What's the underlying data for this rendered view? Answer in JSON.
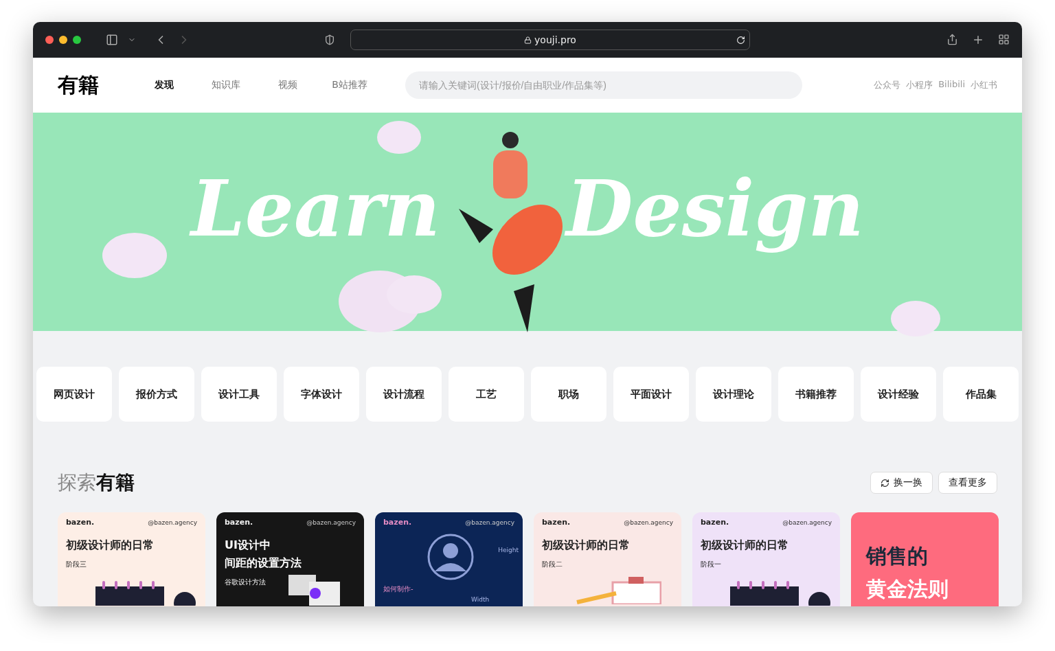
{
  "browser": {
    "url": "youji.pro"
  },
  "header": {
    "logo": "有籍",
    "nav": [
      {
        "label": "发现",
        "selected": true
      },
      {
        "label": "知识库",
        "selected": false
      },
      {
        "label": "视频",
        "selected": false
      },
      {
        "label": "B站推荐",
        "selected": false
      }
    ],
    "search": {
      "placeholder": "请输入关键词(设计/报价/自由职业/作品集等)"
    },
    "links": [
      "公众号",
      "小程序",
      "Bilibili",
      "小红书"
    ]
  },
  "hero": {
    "words": [
      "Learn",
      "Design"
    ]
  },
  "categories": [
    "网页设计",
    "报价方式",
    "设计工具",
    "字体设计",
    "设计流程",
    "工艺",
    "职场",
    "平面设计",
    "设计理论",
    "书籍推荐",
    "设计经验",
    "作品集"
  ],
  "explore": {
    "title_light": "探索",
    "title_bold": "有籍",
    "refresh": "换一换",
    "more": "查看更多",
    "cards": [
      {
        "kind": "calendar",
        "color": "#fdeee6",
        "brand": "bazen.",
        "handle": "@bazen.agency",
        "title": [
          "初级设计师的日常"
        ],
        "subtitle": "阶段三"
      },
      {
        "kind": "dark",
        "color": "#161616",
        "brand": "bazen.",
        "handle": "@bazen.agency",
        "title": [
          "UI设计中",
          "间距的设置方法"
        ],
        "subtitle": "谷歌设计方法"
      },
      {
        "kind": "avatar",
        "color": "#0c2556",
        "brand": "bazen.",
        "handle": "@bazen.agency",
        "subtitle": "如何制作-",
        "height_label": "Height",
        "width_label": "Width"
      },
      {
        "kind": "clipboard",
        "color": "#fae8e6",
        "brand": "bazen.",
        "handle": "@bazen.agency",
        "title": [
          "初级设计师的日常"
        ],
        "subtitle": "阶段二"
      },
      {
        "kind": "calendar",
        "color": "#efe2f8",
        "brand": "bazen.",
        "handle": "@bazen.agency",
        "title": [
          "初级设计师的日常"
        ],
        "subtitle": "阶段一"
      },
      {
        "kind": "poster",
        "color": "#fe6b7e",
        "title": [
          "销售的",
          "黄金法则"
        ]
      }
    ]
  }
}
